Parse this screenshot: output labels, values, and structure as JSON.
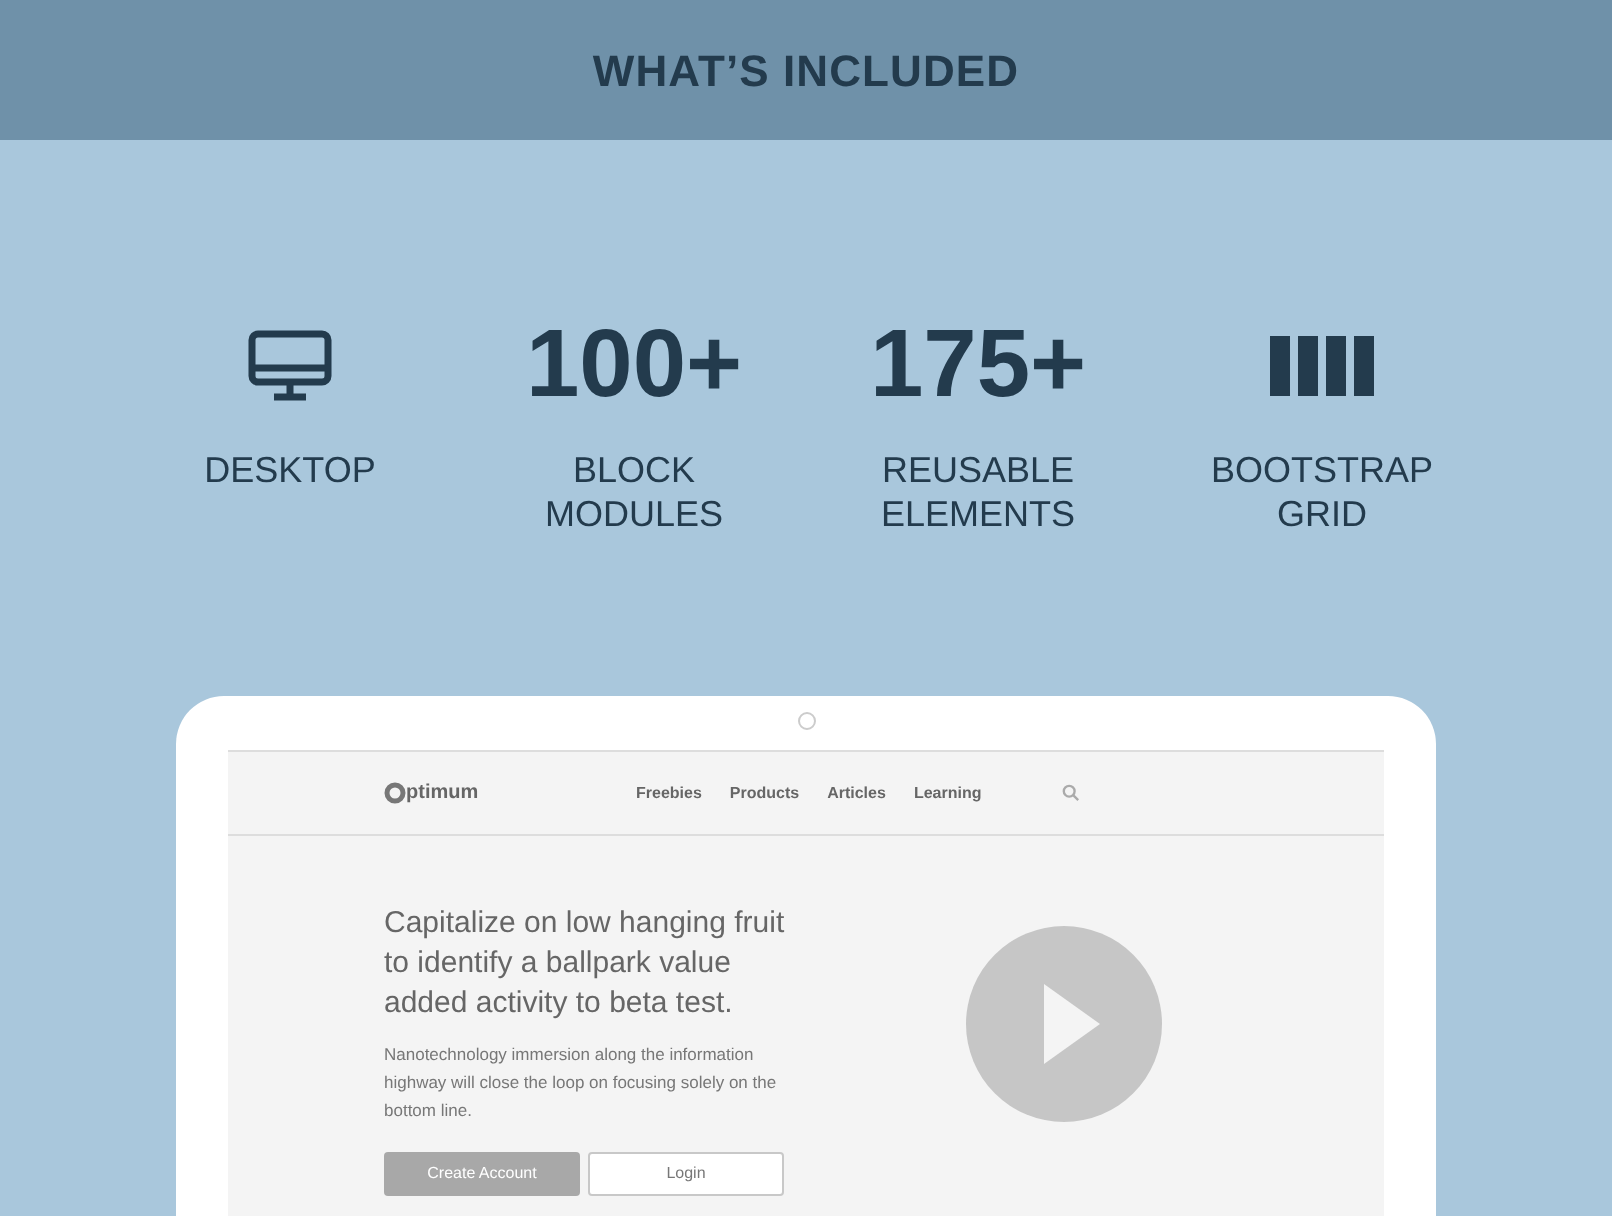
{
  "header": {
    "title": "WHAT’S INCLUDED"
  },
  "features": [
    {
      "kind": "desktop",
      "label": "DESKTOP"
    },
    {
      "kind": "number",
      "value": "100+",
      "label": "BLOCK MODULES"
    },
    {
      "kind": "number",
      "value": "175+",
      "label": "REUSABLE ELEMENTS"
    },
    {
      "kind": "columns",
      "label": "BOOTSTRAP GRID"
    }
  ],
  "preview": {
    "logo": "ptimum",
    "nav": [
      "Freebies",
      "Products",
      "Articles",
      "Learning"
    ],
    "headline": "Capitalize on low hanging fruit to identify a ballpark value added activity to beta test.",
    "body": "Nanotechnology immersion along the information highway will close the loop on focusing solely on the bottom line.",
    "buttons": [
      {
        "label": "Create Account",
        "kind": "primary"
      },
      {
        "label": "Login",
        "kind": "outline"
      }
    ]
  }
}
